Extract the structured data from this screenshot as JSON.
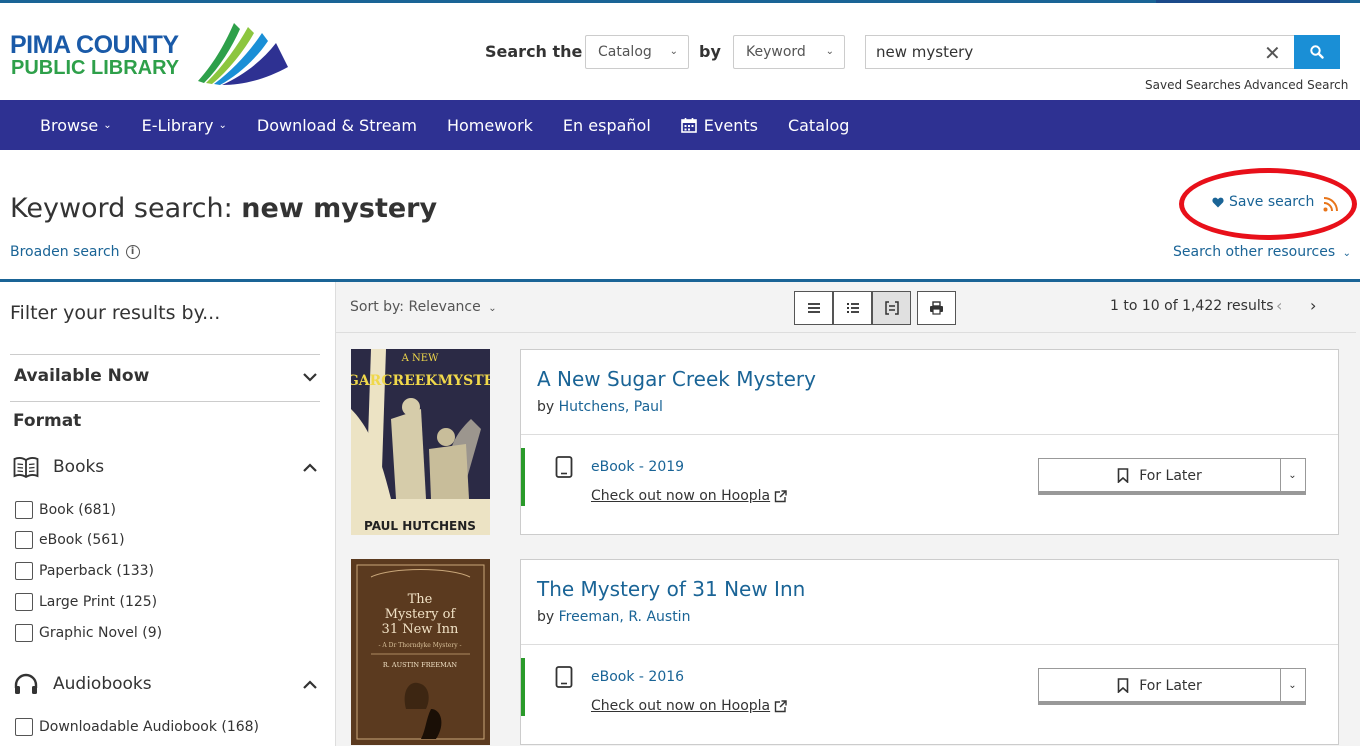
{
  "brand": {
    "line1": "PIMA COUNTY",
    "line2": "PUBLIC LIBRARY",
    "blue": "#1a5aa8",
    "green": "#2ea04a"
  },
  "search": {
    "label": "Search the",
    "scope": "Catalog",
    "by_label": "by",
    "field": "Keyword",
    "query": "new mystery",
    "saved_searches": "Saved Searches",
    "advanced_search": "Advanced Search"
  },
  "nav": {
    "color": "#2e3192",
    "items": [
      {
        "label": "Browse",
        "dropdown": true
      },
      {
        "label": "E-Library",
        "dropdown": true
      },
      {
        "label": "Download & Stream"
      },
      {
        "label": "Homework"
      },
      {
        "label": "En español"
      },
      {
        "label": "Events",
        "icon": "calendar-icon"
      },
      {
        "label": "Catalog"
      }
    ]
  },
  "heading": {
    "prefix": "Keyword search:",
    "query": "new mystery",
    "broaden": "Broaden search",
    "save_search": "Save search",
    "other_resources": "Search other resources"
  },
  "sidebar": {
    "title": "Filter your results by...",
    "available_now": "Available Now",
    "format": "Format",
    "books": {
      "label": "Books",
      "options": [
        "Book (681)",
        "eBook (561)",
        "Paperback (133)",
        "Large Print (125)",
        "Graphic Novel (9)"
      ]
    },
    "audiobooks": {
      "label": "Audiobooks",
      "options": [
        "Downloadable Audiobook (168)"
      ]
    }
  },
  "results": {
    "sort": "Sort by: Relevance",
    "range": "1 to 10 of 1,422 results",
    "items": [
      {
        "title": "A New Sugar Creek Mystery",
        "by": "by",
        "author": "Hutchens, Paul",
        "format": "eBook - 2019",
        "checkout": "Check out now on Hoopla",
        "for_later": "For Later",
        "cover_title": "A NEW SUGAR CREEK MYSTERY",
        "cover_author": "PAUL HUTCHENS"
      },
      {
        "title": "The Mystery of 31 New Inn",
        "by": "by",
        "author": "Freeman, R. Austin",
        "format": "eBook - 2016",
        "checkout": "Check out now on Hoopla",
        "for_later": "For Later",
        "cover_title1": "The",
        "cover_title2": "Mystery of",
        "cover_title3": "31 New Inn",
        "cover_series": "- A Dr Thorndyke Mystery -",
        "cover_author": "R. AUSTIN FREEMAN"
      }
    ]
  }
}
